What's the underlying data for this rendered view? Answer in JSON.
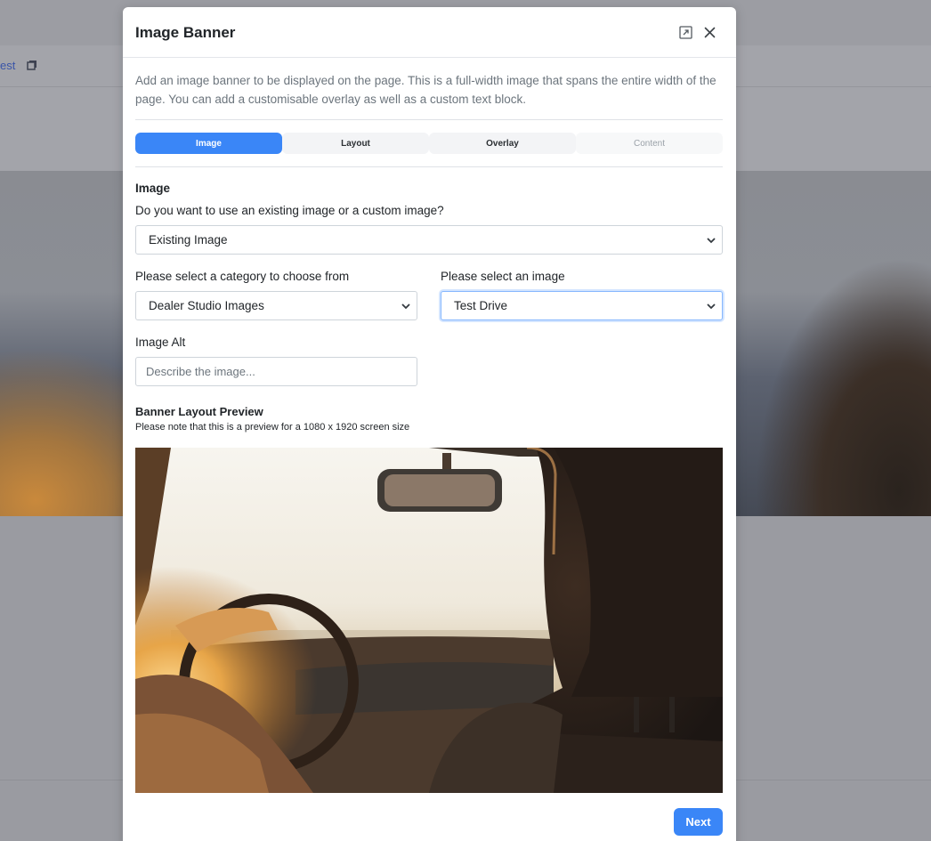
{
  "background": {
    "link_text": "est",
    "copy_icon": "copy-icon"
  },
  "modal": {
    "title": "Image Banner",
    "expand_icon": "expand-icon",
    "close_icon": "close-icon",
    "description": "Add an image banner to be displayed on the page. This is a full-width image that spans the entire width of the page. You can add a customisable overlay as well as a custom text block.",
    "tabs": [
      {
        "label": "Image",
        "state": "active"
      },
      {
        "label": "Layout",
        "state": "default"
      },
      {
        "label": "Overlay",
        "state": "default"
      },
      {
        "label": "Content",
        "state": "disabled"
      }
    ],
    "image_section": {
      "title": "Image",
      "source_question": "Do you want to use an existing image or a custom image?",
      "source_value": "Existing Image",
      "category_label": "Please select a category to choose from",
      "category_value": "Dealer Studio Images",
      "image_label": "Please select an image",
      "image_value": "Test Drive",
      "alt_label": "Image Alt",
      "alt_placeholder": "Describe the image...",
      "alt_value": ""
    },
    "preview": {
      "title": "Banner Layout Preview",
      "note": "Please note that this is a preview for a 1080 x 1920 screen size",
      "image_subject": "driver-in-car-sunlight-photo"
    },
    "next_label": "Next"
  },
  "colors": {
    "accent": "#3a86f7",
    "focus_ring": "#86b7fe",
    "overlay": "#9a9ba1"
  }
}
